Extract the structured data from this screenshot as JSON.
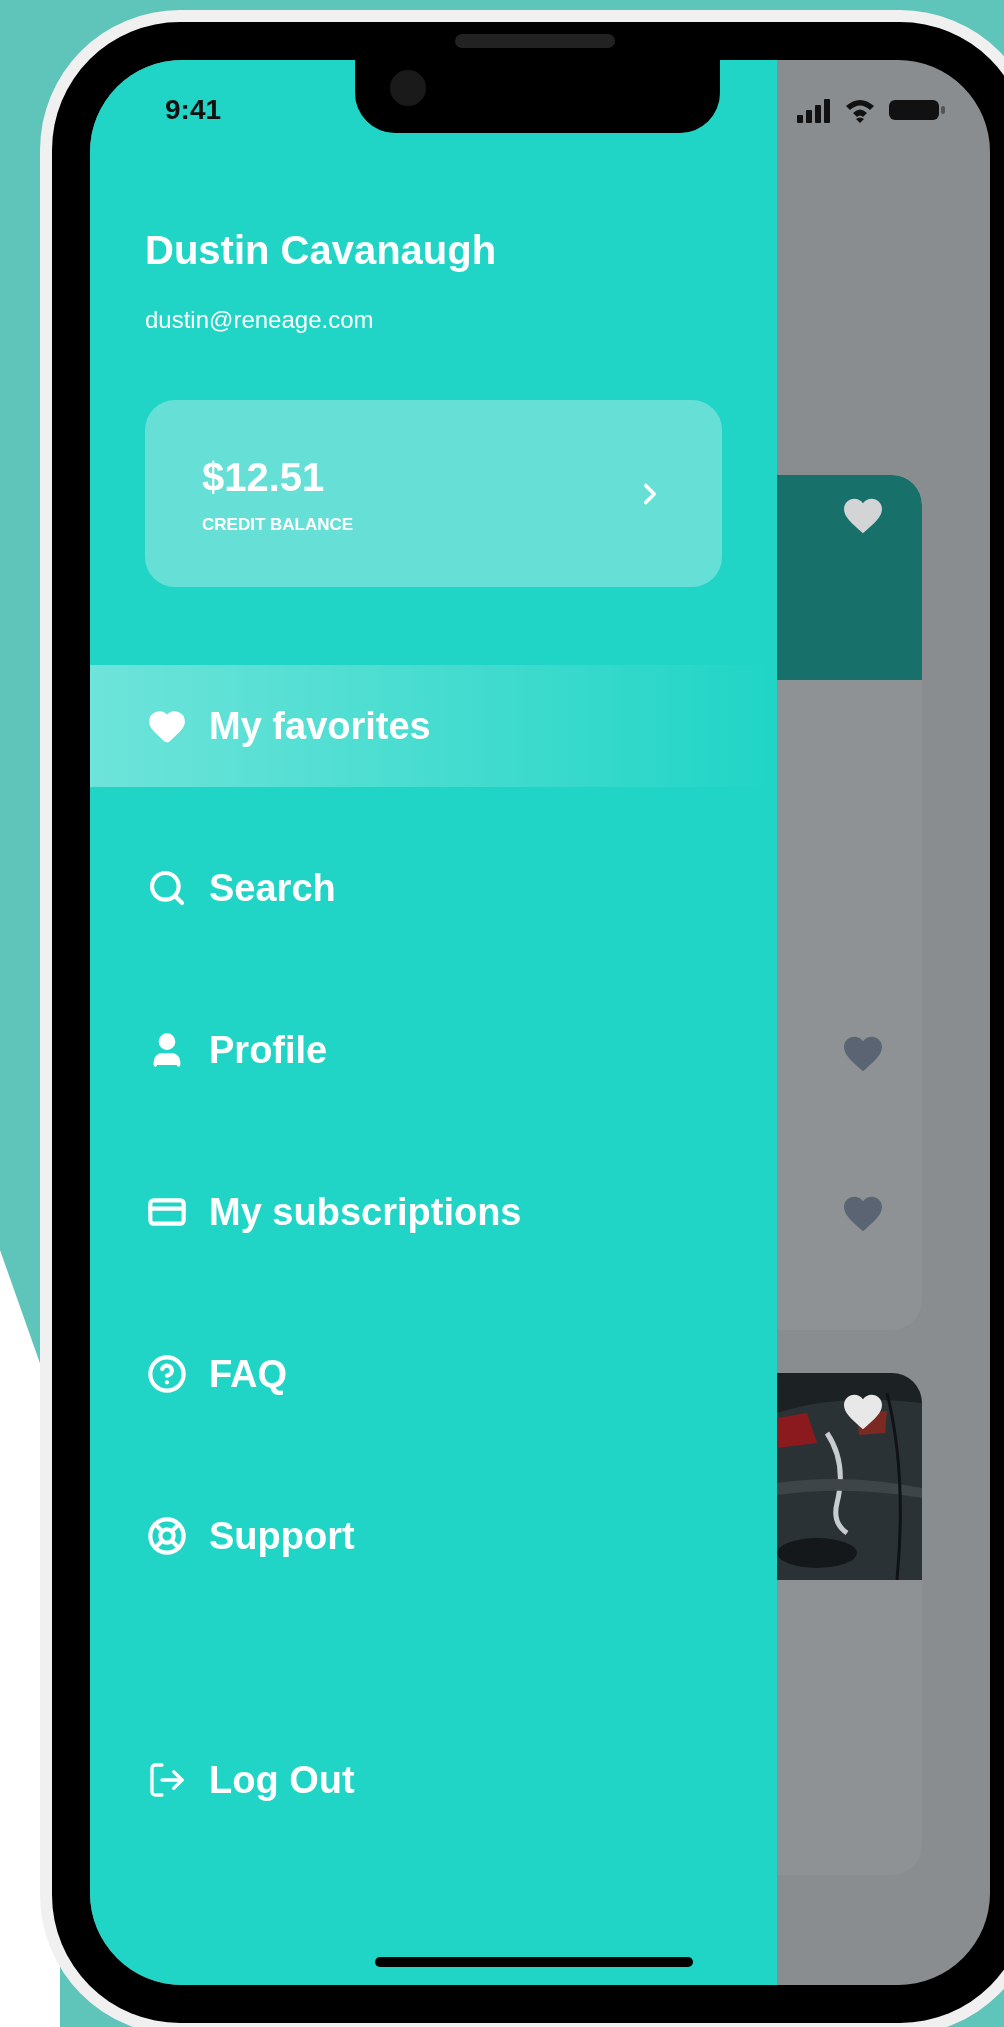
{
  "status_bar": {
    "time": "9:41"
  },
  "user": {
    "name": "Dustin Cavanaugh",
    "email": "dustin@reneage.com"
  },
  "credit": {
    "amount": "$12.51",
    "label": "CREDIT BALANCE"
  },
  "menu": [
    {
      "label": "My favorites",
      "selected": true
    },
    {
      "label": "Search",
      "selected": false
    },
    {
      "label": "Profile",
      "selected": false
    },
    {
      "label": "My subscriptions",
      "selected": false
    },
    {
      "label": "FAQ",
      "selected": false
    },
    {
      "label": "Support",
      "selected": false
    }
  ],
  "logout": {
    "label": "Log Out"
  }
}
